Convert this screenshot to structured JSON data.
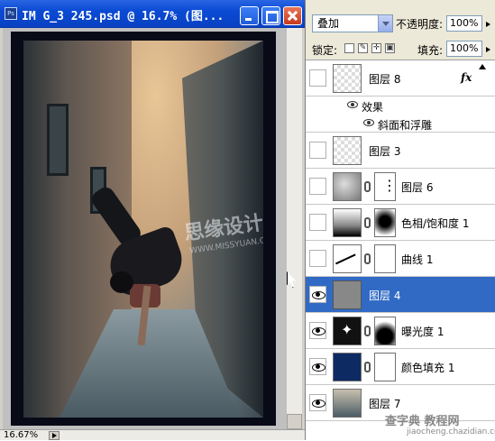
{
  "window": {
    "title": "IM G_3 245.psd @ 16.7% (图..."
  },
  "status": {
    "zoom": "16.67%"
  },
  "canvas": {
    "watermark": "思缘设计",
    "watermark_sub": "WWW.MISSYUAN.COM"
  },
  "layers_panel": {
    "blend_mode": "叠加",
    "opacity_label": "不透明度:",
    "opacity_value": "100%",
    "lock_label": "锁定:",
    "fill_label": "填充:",
    "fill_value": "100%",
    "layers": [
      {
        "name": "图层 8",
        "visible": false,
        "fx": "fx",
        "selected": false
      },
      {
        "name": "图层 3",
        "visible": false,
        "selected": false
      },
      {
        "name": "图层 6",
        "visible": false,
        "selected": false
      },
      {
        "name": "色相/饱和度 1",
        "visible": false,
        "selected": false
      },
      {
        "name": "曲线 1",
        "visible": false,
        "selected": false
      },
      {
        "name": "图层 4",
        "visible": true,
        "selected": true
      },
      {
        "name": "曝光度 1",
        "visible": true,
        "selected": false
      },
      {
        "name": "颜色填充 1",
        "visible": true,
        "selected": false
      },
      {
        "name": "图层 7",
        "visible": true,
        "selected": false
      }
    ],
    "effects_label": "效果",
    "effect_item": "斜面和浮雕"
  },
  "footer_watermark": {
    "text": "查字典 教程网",
    "url": "jiaocheng.chazidian.com"
  }
}
